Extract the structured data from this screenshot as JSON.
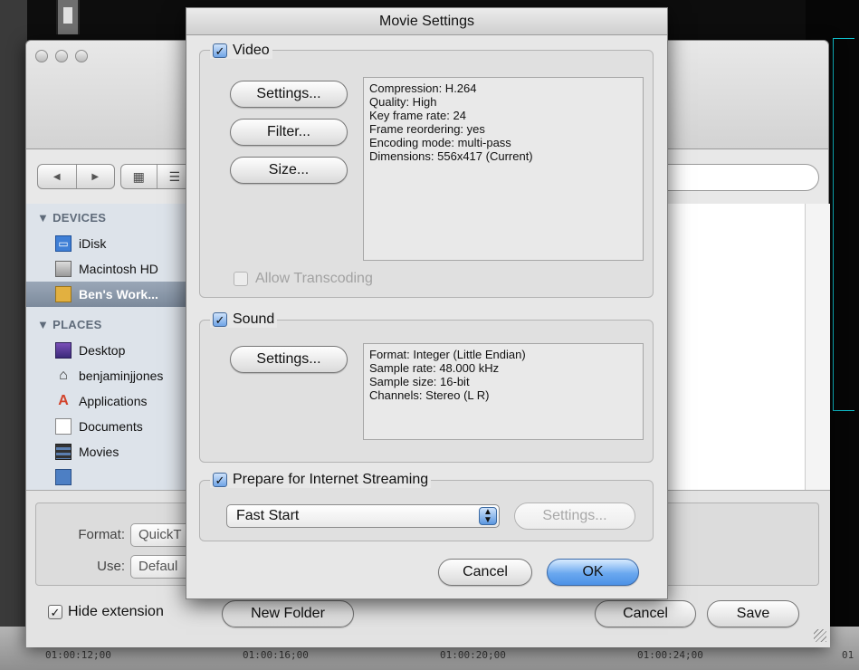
{
  "timeline": {
    "timecodes": [
      "01:00:12;00",
      "01:00:16;00",
      "01:00:20;00",
      "01:00:24;00",
      "01"
    ]
  },
  "save_panel": {
    "sidebar": {
      "devices_header": "DEVICES",
      "places_header": "PLACES",
      "devices": [
        {
          "label": "iDisk",
          "icon": "idisk-icon"
        },
        {
          "label": "Macintosh HD",
          "icon": "hard-drive-icon"
        },
        {
          "label": "Ben's Work...",
          "icon": "external-drive-icon",
          "selected": true
        }
      ],
      "places": [
        {
          "label": "Desktop",
          "icon": "desktop-icon"
        },
        {
          "label": "benjaminjjones",
          "icon": "home-icon"
        },
        {
          "label": "Applications",
          "icon": "applications-icon"
        },
        {
          "label": "Documents",
          "icon": "documents-icon"
        },
        {
          "label": "Movies",
          "icon": "movies-icon"
        }
      ]
    },
    "format_label": "Format:",
    "format_value": "QuickT",
    "use_label": "Use:",
    "use_value": "Defaul",
    "hide_extension_label": "Hide extension",
    "hide_extension_checked": true,
    "new_folder_label": "New Folder",
    "cancel_label": "Cancel",
    "save_label": "Save"
  },
  "movie_settings": {
    "title": "Movie Settings",
    "video": {
      "label": "Video",
      "checked": true,
      "settings_button": "Settings...",
      "filter_button": "Filter...",
      "size_button": "Size...",
      "info_lines": [
        "Compression: H.264",
        "Quality: High",
        "Key frame rate: 24",
        "Frame reordering: yes",
        "Encoding mode: multi-pass",
        "Dimensions: 556x417 (Current)"
      ],
      "allow_transcoding_label": "Allow Transcoding",
      "allow_transcoding_checked": false
    },
    "sound": {
      "label": "Sound",
      "checked": true,
      "settings_button": "Settings...",
      "info_lines": [
        "Format: Integer (Little Endian)",
        "Sample rate: 48.000 kHz",
        "Sample size: 16-bit",
        "Channels: Stereo (L R)"
      ]
    },
    "streaming": {
      "label": "Prepare for Internet Streaming",
      "checked": true,
      "popup_value": "Fast Start",
      "settings_button": "Settings..."
    },
    "cancel_label": "Cancel",
    "ok_label": "OK"
  },
  "colors": {
    "accent_blue": "#5b97e0",
    "selection_gray": "#8a98aa",
    "timeline_outline": "#0fc2cf"
  }
}
